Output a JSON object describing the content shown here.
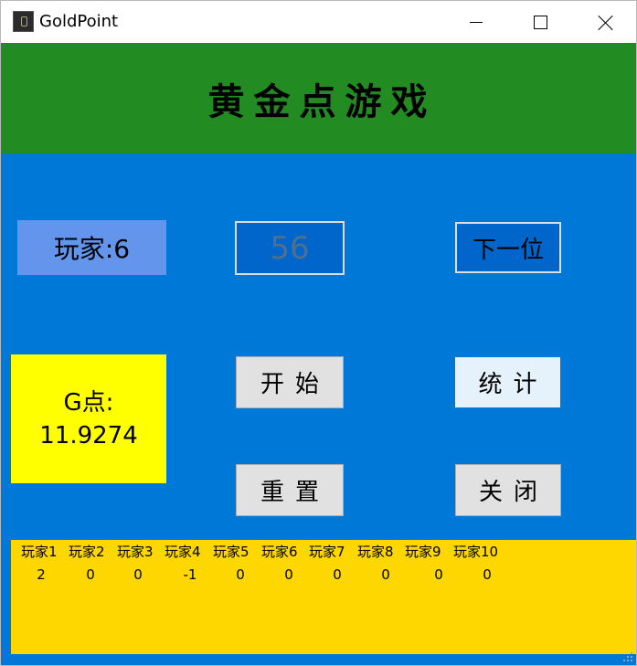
{
  "window": {
    "title": "GoldPoint"
  },
  "header": {
    "title": "黄金点游戏"
  },
  "controls": {
    "player_label": "玩家:6",
    "number_input_value": "56",
    "next_label": "下一位",
    "start_label": "开始",
    "stats_label": "统计",
    "reset_label": "重置",
    "exit_label": "关闭"
  },
  "gpoint": {
    "label": "G点:",
    "value": "11.9274"
  },
  "scores": {
    "players": [
      {
        "name": "玩家1",
        "score": "2"
      },
      {
        "name": "玩家2",
        "score": "0"
      },
      {
        "name": "玩家3",
        "score": "0"
      },
      {
        "name": "玩家4",
        "score": "-1"
      },
      {
        "name": "玩家5",
        "score": "0"
      },
      {
        "name": "玩家6",
        "score": "0"
      },
      {
        "name": "玩家7",
        "score": "0"
      },
      {
        "name": "玩家8",
        "score": "0"
      },
      {
        "name": "玩家9",
        "score": "0"
      },
      {
        "name": "玩家10",
        "score": "0"
      }
    ]
  },
  "colors": {
    "background": "#0078d7",
    "banner": "#228b22",
    "player_label_bg": "#6495ed",
    "gpoint_bg": "#ffff00",
    "score_panel_bg": "#ffd700",
    "input_bg": "#0066cc"
  },
  "icons": {
    "app": "app-icon",
    "minimize": "minimize-icon",
    "maximize": "maximize-icon",
    "close": "close-icon",
    "resize": "resize-grip-icon"
  }
}
